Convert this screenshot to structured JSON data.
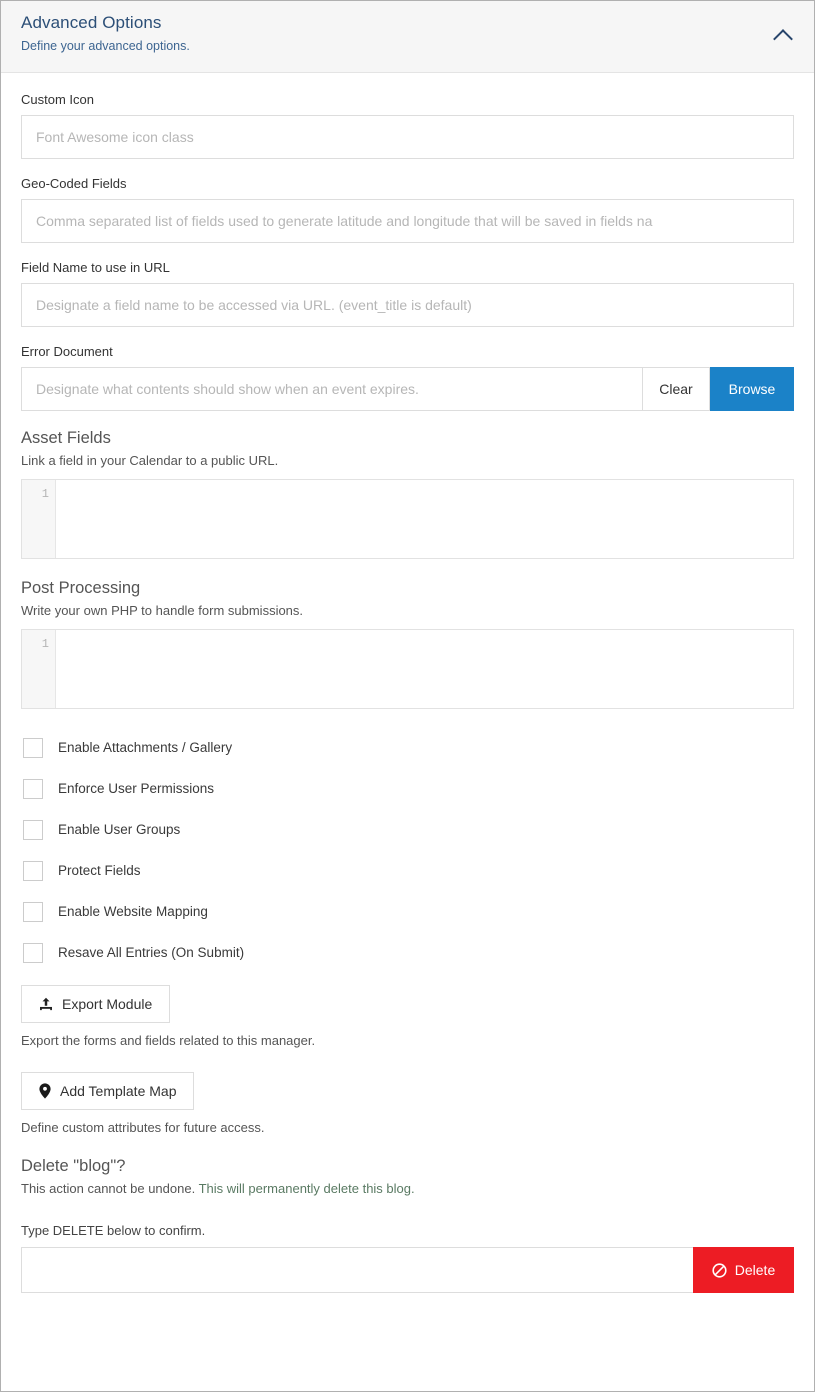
{
  "header": {
    "title": "Advanced Options",
    "subtitle": "Define your advanced options.",
    "collapse_icon": "chevron-up-icon"
  },
  "colors": {
    "header_title": "#2c4f77",
    "browse_button": "#1b82c8",
    "delete_button": "#ed1c24",
    "border": "#dddddd"
  },
  "fields": [
    {
      "label": "Custom Icon",
      "placeholder": "Font Awesome icon class",
      "value": ""
    },
    {
      "label": "Geo-Coded Fields",
      "placeholder": "Comma separated list of fields used to generate latitude and longitude that will be saved in fields na",
      "value": ""
    },
    {
      "label": "Field Name to use in URL",
      "placeholder": "Designate a field name to be accessed via URL. (event_title is default)",
      "value": ""
    }
  ],
  "error_document": {
    "label": "Error Document",
    "placeholder": "Designate what contents should show when an event expires.",
    "value": "",
    "clear_label": "Clear",
    "browse_label": "Browse"
  },
  "sections": [
    {
      "title": "Asset Fields",
      "description": "Link a field in your Calendar to a public URL.",
      "line_number": "1",
      "code": ""
    },
    {
      "title": "Post Processing",
      "description": "Write your own PHP to handle form submissions.",
      "line_number": "1",
      "code": ""
    }
  ],
  "checkboxes": [
    {
      "label": "Enable Attachments / Gallery",
      "checked": false
    },
    {
      "label": "Enforce User Permissions",
      "checked": false
    },
    {
      "label": "Enable User Groups",
      "checked": false
    },
    {
      "label": "Protect Fields",
      "checked": false
    },
    {
      "label": "Enable Website Mapping",
      "checked": false
    },
    {
      "label": "Resave All Entries (On Submit)",
      "checked": false
    }
  ],
  "export_action": {
    "button_label": "Export Module",
    "icon": "upload-icon",
    "description": "Export the forms and fields related to this manager."
  },
  "template_map_action": {
    "button_label": "Add Template Map",
    "icon": "map-pin-icon",
    "description": "Define custom attributes for future access."
  },
  "delete_section": {
    "title": "Delete \"blog\"?",
    "warning_part1": "This action cannot be undone. ",
    "warning_part2": "This will permanently delete this blog.",
    "confirm_label": "Type DELETE below to confirm.",
    "input_value": "",
    "input_placeholder": "",
    "button_label": "Delete",
    "button_icon": "ban-icon"
  }
}
